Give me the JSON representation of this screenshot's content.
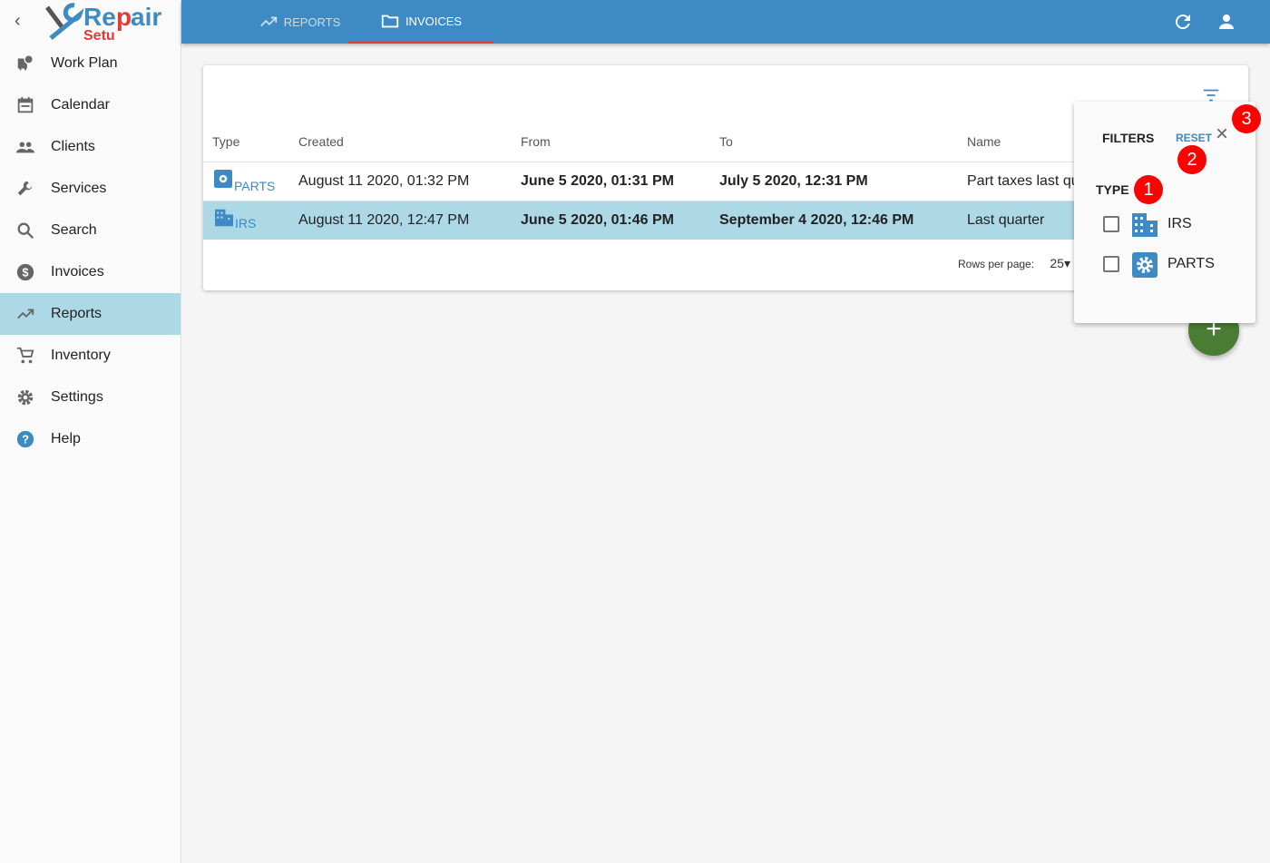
{
  "logo": {
    "text": "RepairSetup"
  },
  "sidebar": {
    "items": [
      {
        "label": "Work Plan",
        "icon": "bus-clock-icon"
      },
      {
        "label": "Calendar",
        "icon": "calendar-icon"
      },
      {
        "label": "Clients",
        "icon": "people-icon"
      },
      {
        "label": "Services",
        "icon": "wrench-icon"
      },
      {
        "label": "Search",
        "icon": "search-icon"
      },
      {
        "label": "Invoices",
        "icon": "dollar-icon"
      },
      {
        "label": "Reports",
        "icon": "trending-up-icon",
        "active": true
      },
      {
        "label": "Inventory",
        "icon": "cart-icon"
      },
      {
        "label": "Settings",
        "icon": "gear-icon"
      },
      {
        "label": "Help",
        "icon": "help-icon"
      }
    ]
  },
  "topbar": {
    "tabs": [
      {
        "label": "REPORTS"
      },
      {
        "label": "INVOICES",
        "active": true
      }
    ]
  },
  "table": {
    "headers": [
      "Type",
      "Created",
      "From",
      "To",
      "Name"
    ],
    "rows": [
      {
        "type": "PARTS",
        "created": "August 11 2020, 01:32 PM",
        "from": "June 5 2020, 01:31 PM",
        "to": "July 5 2020, 12:31 PM",
        "name": "Part taxes last quarter"
      },
      {
        "type": "IRS",
        "created": "August 11 2020, 12:47 PM",
        "from": "June 5 2020, 01:46 PM",
        "to": "September 4 2020, 12:46 PM",
        "name": "Last quarter",
        "selected": true
      }
    ]
  },
  "pagination": {
    "rows_per_page_label": "Rows per page:",
    "rows_per_page": "25"
  },
  "filters": {
    "title": "FILTERS",
    "reset": "RESET",
    "type_label": "TYPE",
    "options": [
      {
        "label": "IRS",
        "checked": false
      },
      {
        "label": "PARTS",
        "checked": false
      }
    ]
  },
  "badges": [
    "1",
    "2",
    "3"
  ],
  "fab": {
    "label": "+"
  },
  "colors": {
    "primary": "#3d8ac4",
    "selected_row": "#add8e6",
    "fab": "#4a7c34",
    "badge": "#ff0000",
    "tab_indicator": "#e53935"
  }
}
